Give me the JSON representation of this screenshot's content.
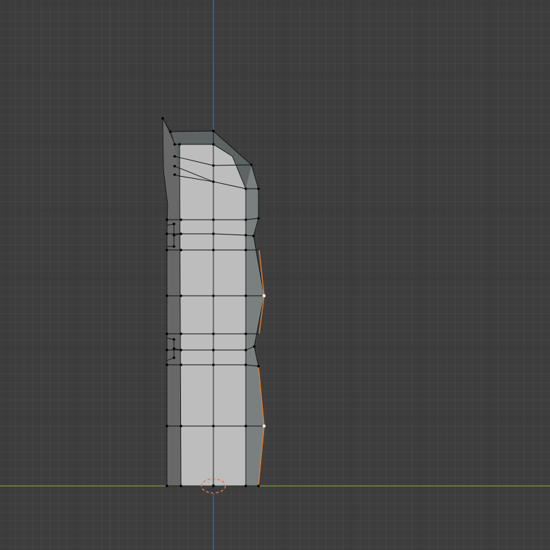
{
  "viewport": {
    "view": "front-orthographic",
    "mode": "edit-mode",
    "background_color": "#3d3d3d"
  },
  "axes": {
    "z_axis_color": "#2f63c6",
    "x_axis_color": "#6f8a3b"
  },
  "mesh": {
    "front_face_color": "#bdbdbd",
    "left_side_color": "#686868",
    "right_side_color": "#7a807f",
    "top_face_color": "#5e6463",
    "edge_color": "#111111",
    "vertex_color": "#000000",
    "selected_edge_color": "#e07a2e",
    "selected_vertex_color": "#f0f0f0"
  },
  "object_origin": {
    "icon": "3d-cursor-icon",
    "ring_color": "#e0794a"
  }
}
